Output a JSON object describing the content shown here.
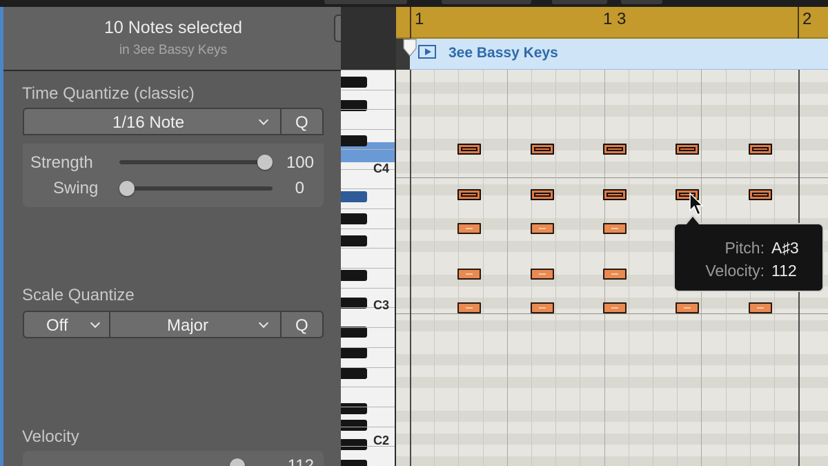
{
  "selection": {
    "count_text": "10 Notes selected",
    "region_text": "in 3ee Bassy Keys"
  },
  "time_quantize": {
    "title": "Time Quantize (classic)",
    "value": "1/16 Note",
    "q_label": "Q",
    "strength_label": "Strength",
    "strength_value": "100",
    "strength_level": 1.0,
    "swing_label": "Swing",
    "swing_value": "0",
    "swing_level": 0.0
  },
  "scale_quantize": {
    "title": "Scale Quantize",
    "mode": "Off",
    "scale": "Major",
    "q_label": "Q"
  },
  "velocity": {
    "title": "Velocity",
    "value": "112"
  },
  "keyboard": {
    "labels": [
      "C4",
      "C3",
      "C2"
    ]
  },
  "ruler": {
    "markers": [
      "1",
      "1 3",
      "2"
    ]
  },
  "region": {
    "name": "3ee Bassy Keys",
    "color": "#cfe4f7"
  },
  "tooltip": {
    "pitch_label": "Pitch:",
    "pitch_value": "A♯3",
    "velocity_label": "Velocity:",
    "velocity_value": "112"
  },
  "colors": {
    "ruler": "#c49a2c",
    "note": "#e88a52",
    "selected_key": "#6a9ad6"
  },
  "icons": [
    "menu-toggle-icon",
    "chevron-down-icon",
    "play-icon",
    "playhead-icon",
    "mouse-pointer-icon"
  ]
}
